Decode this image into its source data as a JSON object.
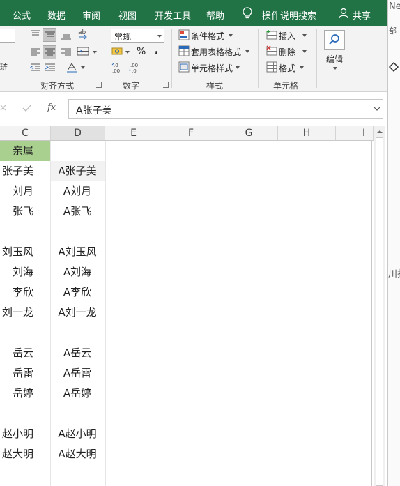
{
  "menu": {
    "tabs": [
      "公式",
      "数据",
      "审阅",
      "视图",
      "开发工具",
      "帮助"
    ],
    "tell_me": "操作说明搜索",
    "share": "共享"
  },
  "ribbon": {
    "number_format": "常规",
    "groups": {
      "alignment": "对齐方式",
      "number": "数字",
      "styles": "样式",
      "cells": "单元格"
    },
    "styles": {
      "conditional": "条件格式",
      "table": "套用表格格式",
      "cell_styles": "单元格样式"
    },
    "cells": {
      "insert": "插入",
      "delete": "删除",
      "format": "格式"
    },
    "edit": "编辑",
    "left_fragment": "                                        ",
    "left_partial": "琏"
  },
  "formula_bar": {
    "value": "A张子美"
  },
  "columns": [
    "C",
    "D",
    "E",
    "F",
    "G",
    "H",
    "I"
  ],
  "rows": [
    {
      "c": "亲属",
      "d": ""
    },
    {
      "c": "张子美",
      "d": "A张子美"
    },
    {
      "c": "刘月",
      "d": "A刘月"
    },
    {
      "c": "张飞",
      "d": "A张飞"
    },
    {
      "c": "",
      "d": ""
    },
    {
      "c": "刘玉风",
      "d": "A刘玉风"
    },
    {
      "c": "刘海",
      "d": "A刘海"
    },
    {
      "c": "李欣",
      "d": "A李欣"
    },
    {
      "c": "刘一龙",
      "d": "A刘一龙"
    },
    {
      "c": "",
      "d": ""
    },
    {
      "c": "岳云",
      "d": "A岳云"
    },
    {
      "c": "岳雷",
      "d": "A岳雷"
    },
    {
      "c": "岳婷",
      "d": "A岳婷"
    },
    {
      "c": "",
      "d": ""
    },
    {
      "c": "赵小明",
      "d": "A赵小明"
    },
    {
      "c": "赵大明",
      "d": "A赵大明"
    },
    {
      "c": "",
      "d": ""
    }
  ],
  "right_pane": {
    "top": "Ne",
    "ribbon": "部",
    "mid": "川拉"
  },
  "colors": {
    "accent": "#217346",
    "header_fill": "#a9d08e",
    "selected_fill": "#f2f2f2"
  }
}
